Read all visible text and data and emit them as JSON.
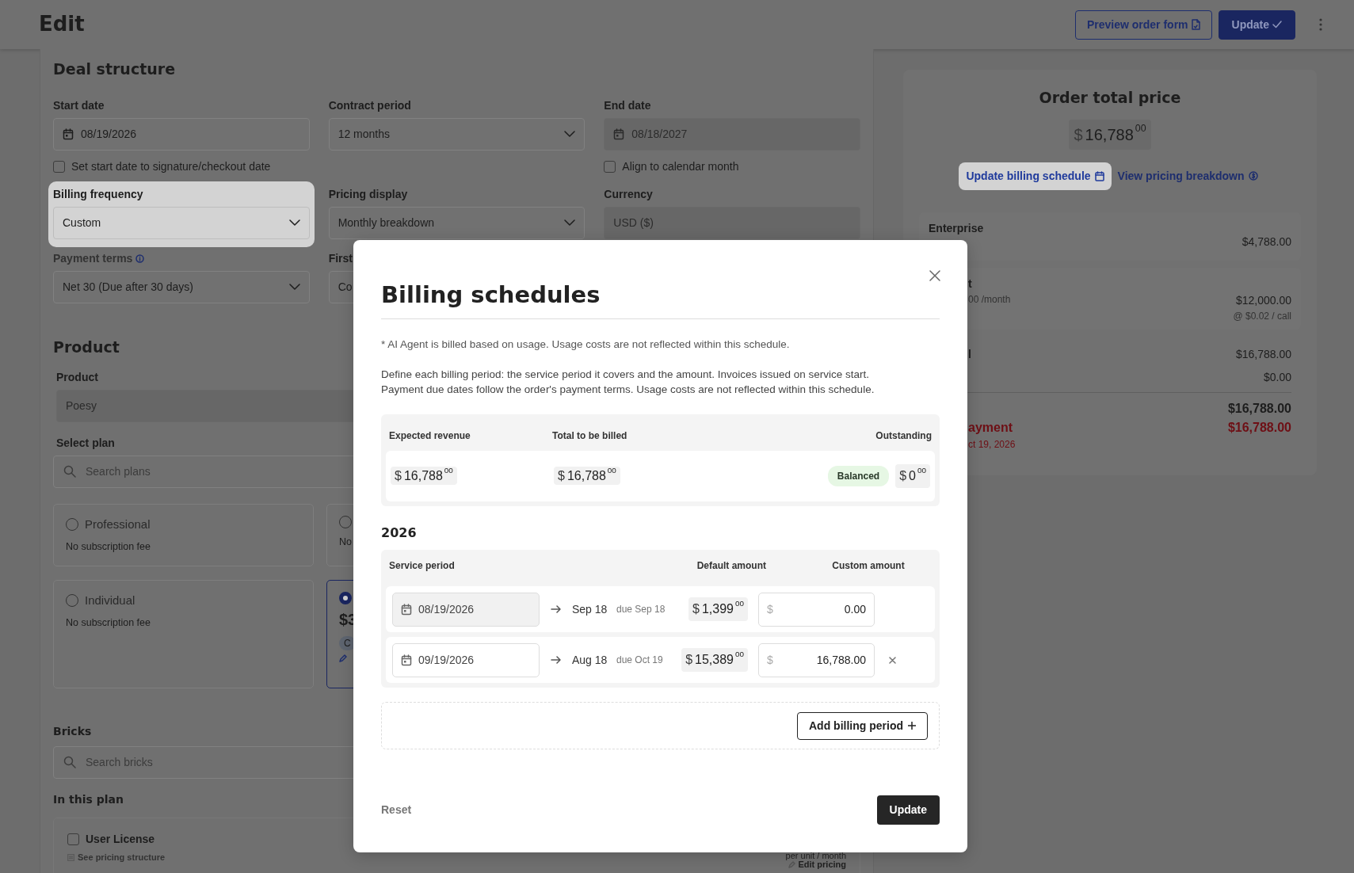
{
  "header": {
    "title": "Edit",
    "buttons": [
      {
        "label": "Preview order form",
        "kind": "outline"
      },
      {
        "label": "Update",
        "kind": "primary"
      }
    ]
  },
  "deal_structure": {
    "title": "Deal structure",
    "fields": [
      {
        "label": "Start date",
        "value": "08/19/2026",
        "kind": "date",
        "disabled": false,
        "checkbox": {
          "label": "Set start date to signature/checkout date",
          "checked": false
        }
      },
      {
        "label": "Contract period",
        "value": "12 months",
        "kind": "select",
        "disabled": false
      },
      {
        "label": "End date",
        "value": "08/18/2027",
        "kind": "date",
        "disabled": true,
        "checkbox": {
          "label": "Align to calendar month",
          "checked": false
        }
      },
      {
        "label": "Billing frequency",
        "value": "Custom",
        "kind": "select",
        "disabled": false,
        "highlighted": true
      },
      {
        "label": "Pricing display",
        "value": "Monthly breakdown",
        "kind": "select",
        "disabled": false
      },
      {
        "label": "Currency",
        "value": "USD ($)",
        "kind": "text",
        "disabled": true
      },
      {
        "label": "Payment terms",
        "value": "Net 30 (Due after 30 days)",
        "kind": "select",
        "disabled": false,
        "info": true
      },
      {
        "label": "First",
        "value": "Co",
        "kind": "text",
        "disabled": false
      }
    ]
  },
  "product": {
    "title": "Product",
    "product_field": {
      "label": "Product",
      "value": "Poesy"
    },
    "select_plan": {
      "label": "Select plan",
      "placeholder": "Search plans"
    },
    "plans": [
      {
        "name": "Professional",
        "fee": "No subscription fee",
        "selected": false
      },
      {
        "fee": "No",
        "selected": false
      },
      {
        "name": "Individual",
        "fee": "No subscription fee",
        "selected": false
      },
      {
        "price": "$3",
        "badge": "C",
        "selected": true
      }
    ]
  },
  "bricks": {
    "title": "Bricks",
    "placeholder": "Search bricks",
    "in_plan_title": "In this plan",
    "items": [
      {
        "name": "User License",
        "checked": false,
        "link": "See pricing structure",
        "unit": "per unit / month",
        "edit": "Edit pricing"
      }
    ]
  },
  "order": {
    "title": "Order total price",
    "total": {
      "currency": "$",
      "whole": "16,788",
      "cents": "00"
    },
    "actions": [
      {
        "label": "Update billing schedule",
        "highlighted": true,
        "kind": "calendar"
      },
      {
        "label": "View pricing breakdown",
        "highlighted": false,
        "kind": "dollar"
      }
    ],
    "items": [
      {
        "name": "Enterprise",
        "amount": "$4,788.00"
      },
      {
        "name": "t",
        "detail": "00 /month",
        "amount": "$12,000.00",
        "note": "@ $0.02 / call"
      }
    ],
    "subtotals": [
      {
        "label": "l",
        "amount": "$16,788.00"
      },
      {
        "amount": "$0.00"
      }
    ],
    "grand_total": "$16,788.00",
    "payment": {
      "label": "ayment",
      "date": "ct 19, 2026",
      "amount": "$16,788.00"
    }
  },
  "modal": {
    "title": "Billing schedules",
    "note": "* AI Agent is billed based on usage. Usage costs are not reflected within this schedule.",
    "description": [
      "Define each billing period: the service period it covers and the amount. Invoices issued on service start.",
      "Payment due dates follow the order's payment terms. Usage costs are not reflected within this schedule."
    ],
    "summary": [
      {
        "label": "Expected revenue",
        "amount": {
          "currency": "$",
          "whole": "16,788",
          "cents": "00"
        }
      },
      {
        "label": "Total to be billed",
        "amount": {
          "currency": "$",
          "whole": "16,788",
          "cents": "00"
        }
      },
      {
        "label": "Outstanding",
        "status": "Balanced",
        "amount": {
          "currency": "$",
          "whole": "0",
          "cents": "00"
        }
      }
    ],
    "year": "2026",
    "columns": [
      "Service period",
      "Default amount",
      "Custom amount"
    ],
    "periods": [
      {
        "start": "08/19/2026",
        "locked": true,
        "end": "Sep 18",
        "due": "due Sep 18",
        "default": {
          "currency": "$",
          "whole": "1,399",
          "cents": "00"
        },
        "custom_currency": "$",
        "custom": "0.00",
        "removable": false
      },
      {
        "start": "09/19/2026",
        "locked": false,
        "end": "Aug 18",
        "due": "due Oct 19",
        "default": {
          "currency": "$",
          "whole": "15,389",
          "cents": "00"
        },
        "custom_currency": "$",
        "custom": "16,788.00",
        "removable": true
      }
    ],
    "add_button": "Add billing period",
    "reset": "Reset",
    "update": "Update"
  }
}
